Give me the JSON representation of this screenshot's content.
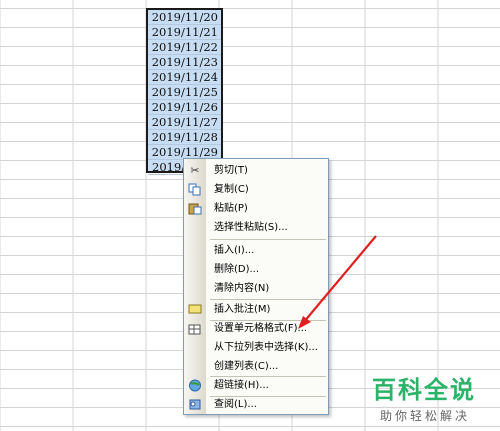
{
  "cells": [
    "2019/11/20",
    "2019/11/21",
    "2019/11/22",
    "2019/11/23",
    "2019/11/24",
    "2019/11/25",
    "2019/11/26",
    "2019/11/27",
    "2019/11/28",
    "2019/11/29",
    "2019/"
  ],
  "menu": {
    "cut": "剪切(T)",
    "copy": "复制(C)",
    "paste": "粘贴(P)",
    "paste_special": "选择性粘贴(S)...",
    "insert": "插入(I)...",
    "delete": "删除(D)...",
    "clear": "清除内容(N)",
    "insert_comment": "插入批注(M)",
    "format_cells": "设置单元格格式(F)...",
    "pick_list": "从下拉列表中选择(K)...",
    "create_list": "创建列表(C)...",
    "hyperlink": "超链接(H)...",
    "lookup": "查阅(L)..."
  },
  "watermark": {
    "title": "百科全说",
    "subtitle": "助你轻松解决"
  },
  "colors": {
    "selection": "#c6ddf3",
    "arrow": "#e02020",
    "brand": "#2bb36a"
  }
}
